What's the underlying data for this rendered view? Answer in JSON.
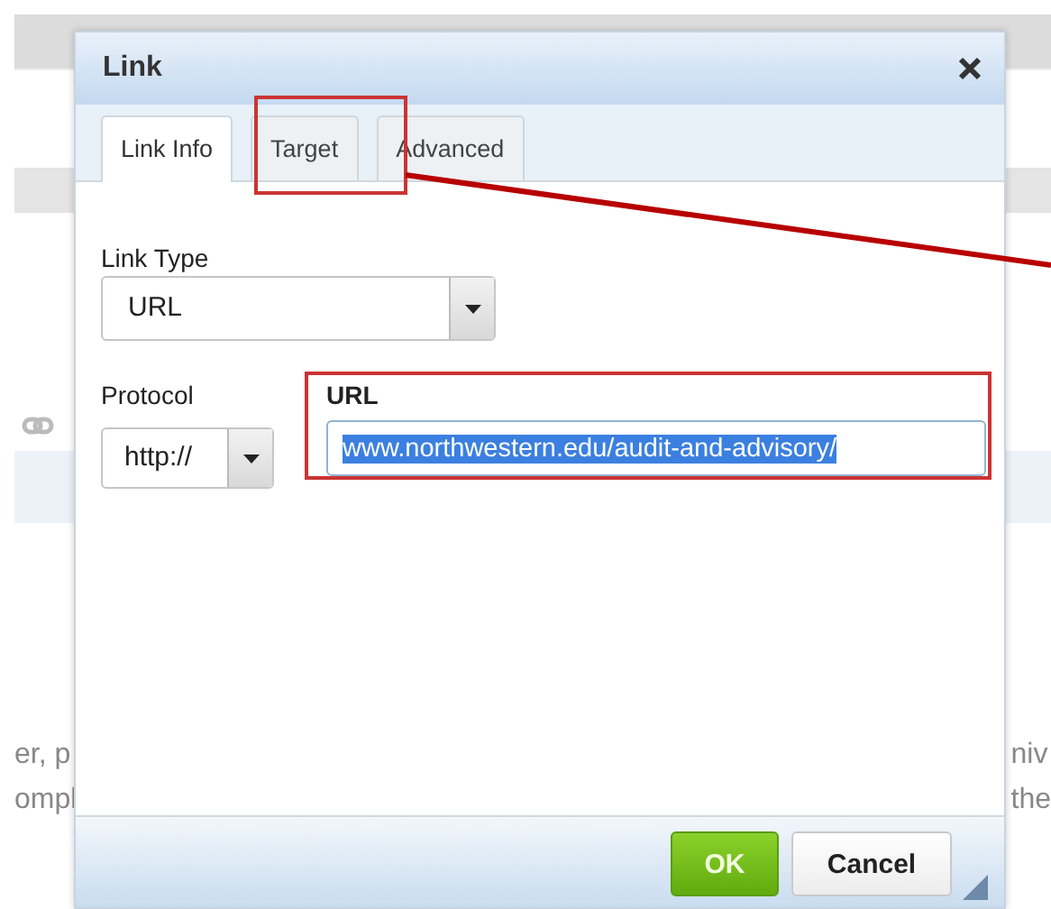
{
  "page": {
    "texts_left": [
      "er, p",
      "ompl"
    ],
    "texts_right": [
      "niv",
      "the"
    ]
  },
  "dialog": {
    "title": "Link",
    "tabs": [
      {
        "label": "Link Info",
        "selected": true
      },
      {
        "label": "Target",
        "selected": false
      },
      {
        "label": "Advanced",
        "selected": false
      }
    ],
    "link_type": {
      "label": "Link Type",
      "value": "URL"
    },
    "protocol": {
      "label": "Protocol",
      "value": "http://"
    },
    "url": {
      "label": "URL",
      "value": "www.northwestern.edu/audit-and-advisory/",
      "highlighted": true
    },
    "buttons": [
      {
        "label": "OK",
        "kind": "primary"
      },
      {
        "label": "Cancel",
        "kind": "secondary"
      }
    ]
  }
}
